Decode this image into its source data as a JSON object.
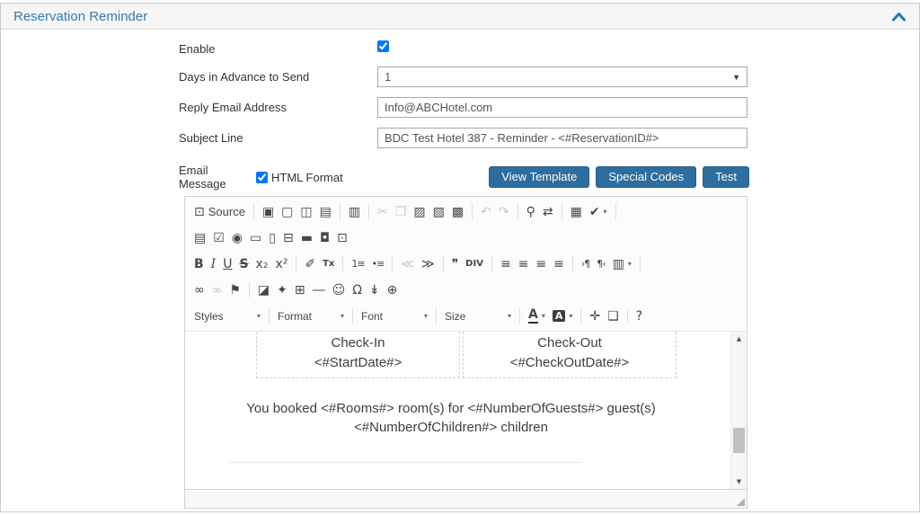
{
  "panel": {
    "title": "Reservation Reminder"
  },
  "form": {
    "enable": {
      "label": "Enable",
      "checked": true
    },
    "days_in_advance": {
      "label": "Days in Advance to Send",
      "value": "1"
    },
    "reply_email": {
      "label": "Reply Email Address",
      "value": "Info@ABCHotel.com"
    },
    "subject_line": {
      "label": "Subject Line",
      "value": "BDC Test Hotel 387 - Reminder - <#ReservationID#>"
    },
    "email_message": {
      "label": "Email Message",
      "html_format_label": "HTML Format",
      "html_format_checked": true
    },
    "buttons": {
      "view_template": "View Template",
      "special_codes": "Special Codes",
      "test": "Test"
    }
  },
  "editor": {
    "toolbar": [
      [
        {
          "n": "source",
          "g": "⊡",
          "label": "Source"
        },
        {
          "t": "sep"
        },
        {
          "n": "save",
          "g": "▣"
        },
        {
          "n": "new-page",
          "g": "▢"
        },
        {
          "n": "preview",
          "g": "◫"
        },
        {
          "n": "print",
          "g": "▤"
        },
        {
          "t": "sep"
        },
        {
          "n": "templates",
          "g": "▥"
        },
        {
          "t": "sep"
        },
        {
          "n": "cut",
          "g": "✂",
          "d": true
        },
        {
          "n": "copy",
          "g": "❐",
          "d": true
        },
        {
          "n": "paste",
          "g": "▨"
        },
        {
          "n": "paste-as-text",
          "g": "▧"
        },
        {
          "n": "paste-from-word",
          "g": "▩"
        },
        {
          "t": "sep"
        },
        {
          "n": "undo",
          "g": "↶",
          "d": true
        },
        {
          "n": "redo",
          "g": "↷",
          "d": true
        },
        {
          "t": "sep"
        },
        {
          "n": "find",
          "g": "⚲"
        },
        {
          "n": "replace",
          "g": "⇄"
        },
        {
          "t": "sep"
        },
        {
          "n": "select-all",
          "g": "▦"
        },
        {
          "n": "spell-check",
          "g": "✔",
          "c": true
        },
        {
          "t": "sep"
        }
      ],
      [
        {
          "n": "form",
          "g": "▤"
        },
        {
          "n": "checkbox-field",
          "g": "☑"
        },
        {
          "n": "radio-button",
          "g": "◉"
        },
        {
          "n": "text-field",
          "g": "▭"
        },
        {
          "n": "textarea-field",
          "g": "▯"
        },
        {
          "n": "select-field",
          "g": "⊟"
        },
        {
          "n": "button-field",
          "g": "▬"
        },
        {
          "n": "image-button",
          "g": "◘"
        },
        {
          "n": "hidden-field",
          "g": "⊡"
        }
      ],
      [
        {
          "n": "bold",
          "g": "B",
          "cls": "b"
        },
        {
          "n": "italic",
          "g": "I",
          "cls": "i"
        },
        {
          "n": "underline",
          "g": "U",
          "cls": "u"
        },
        {
          "n": "strikethrough",
          "g": "S",
          "cls": "s"
        },
        {
          "n": "subscript",
          "g": "x₂"
        },
        {
          "n": "superscript",
          "g": "x²"
        },
        {
          "t": "sep"
        },
        {
          "n": "copy-formatting",
          "g": "✐"
        },
        {
          "n": "remove-format",
          "g": "Tx",
          "cls": "tx"
        },
        {
          "t": "sep"
        },
        {
          "n": "numbered-list",
          "g": "1≡",
          "cls": "w2"
        },
        {
          "n": "bulleted-list",
          "g": "•≡",
          "cls": "w2"
        },
        {
          "t": "sep"
        },
        {
          "n": "decrease-indent",
          "g": "≪",
          "d": true
        },
        {
          "n": "increase-indent",
          "g": "≫"
        },
        {
          "t": "sep"
        },
        {
          "n": "blockquote",
          "g": "❞"
        },
        {
          "n": "create-div",
          "g": "DIV",
          "cls": "tx"
        },
        {
          "t": "sep"
        },
        {
          "n": "align-left",
          "g": "≡"
        },
        {
          "n": "align-center",
          "g": "≡"
        },
        {
          "n": "align-right",
          "g": "≡"
        },
        {
          "n": "justify",
          "g": "≡"
        },
        {
          "t": "sep"
        },
        {
          "n": "text-direction-ltr",
          "g": "›¶",
          "cls": "w2"
        },
        {
          "n": "text-direction-rtl",
          "g": "¶‹",
          "cls": "w2"
        },
        {
          "n": "language",
          "g": "▥",
          "c": true
        },
        {
          "t": "sep"
        }
      ],
      [
        {
          "n": "link",
          "g": "∞"
        },
        {
          "n": "unlink",
          "g": "∞",
          "d": true
        },
        {
          "n": "anchor",
          "g": "⚑"
        },
        {
          "t": "sep"
        },
        {
          "n": "image",
          "g": "◪"
        },
        {
          "n": "flash",
          "g": "✦"
        },
        {
          "n": "table",
          "g": "⊞"
        },
        {
          "n": "horizontal-rule",
          "g": "―"
        },
        {
          "n": "smiley",
          "g": "☺"
        },
        {
          "n": "special-character",
          "g": "Ω"
        },
        {
          "n": "page-break",
          "g": "↡"
        },
        {
          "n": "iframe",
          "g": "⊕"
        }
      ],
      [
        {
          "t": "combo",
          "n": "styles",
          "label": "Styles"
        },
        {
          "t": "sep"
        },
        {
          "t": "combo",
          "n": "paragraph-format",
          "label": "Format"
        },
        {
          "t": "sep"
        },
        {
          "t": "combo",
          "n": "font-name",
          "label": "Font"
        },
        {
          "t": "sep"
        },
        {
          "t": "combo",
          "n": "font-size",
          "label": "Size"
        },
        {
          "t": "sep"
        },
        {
          "n": "text-color",
          "g": "A",
          "cls": "tc",
          "c": true
        },
        {
          "n": "background-color",
          "g": "A",
          "cls": "bg",
          "c": true
        },
        {
          "t": "sep"
        },
        {
          "n": "maximize",
          "g": "✛"
        },
        {
          "n": "show-blocks",
          "g": "❏"
        },
        {
          "t": "sep"
        },
        {
          "n": "about",
          "g": "?"
        }
      ]
    ],
    "content": {
      "table_cells": [
        {
          "title": "Check-In",
          "code": "<#StartDate#>"
        },
        {
          "title": "Check-Out",
          "code": "<#CheckOutDate#>"
        }
      ],
      "line1": "You booked <#Rooms#> room(s) for <#NumberOfGuests#> guest(s)",
      "line2": "<#NumberOfChildren#> children"
    }
  },
  "colors": {
    "accent_blue": "#337ab7",
    "button_bg": "#2e6d9e",
    "header_bg": "#f6f6f6"
  }
}
